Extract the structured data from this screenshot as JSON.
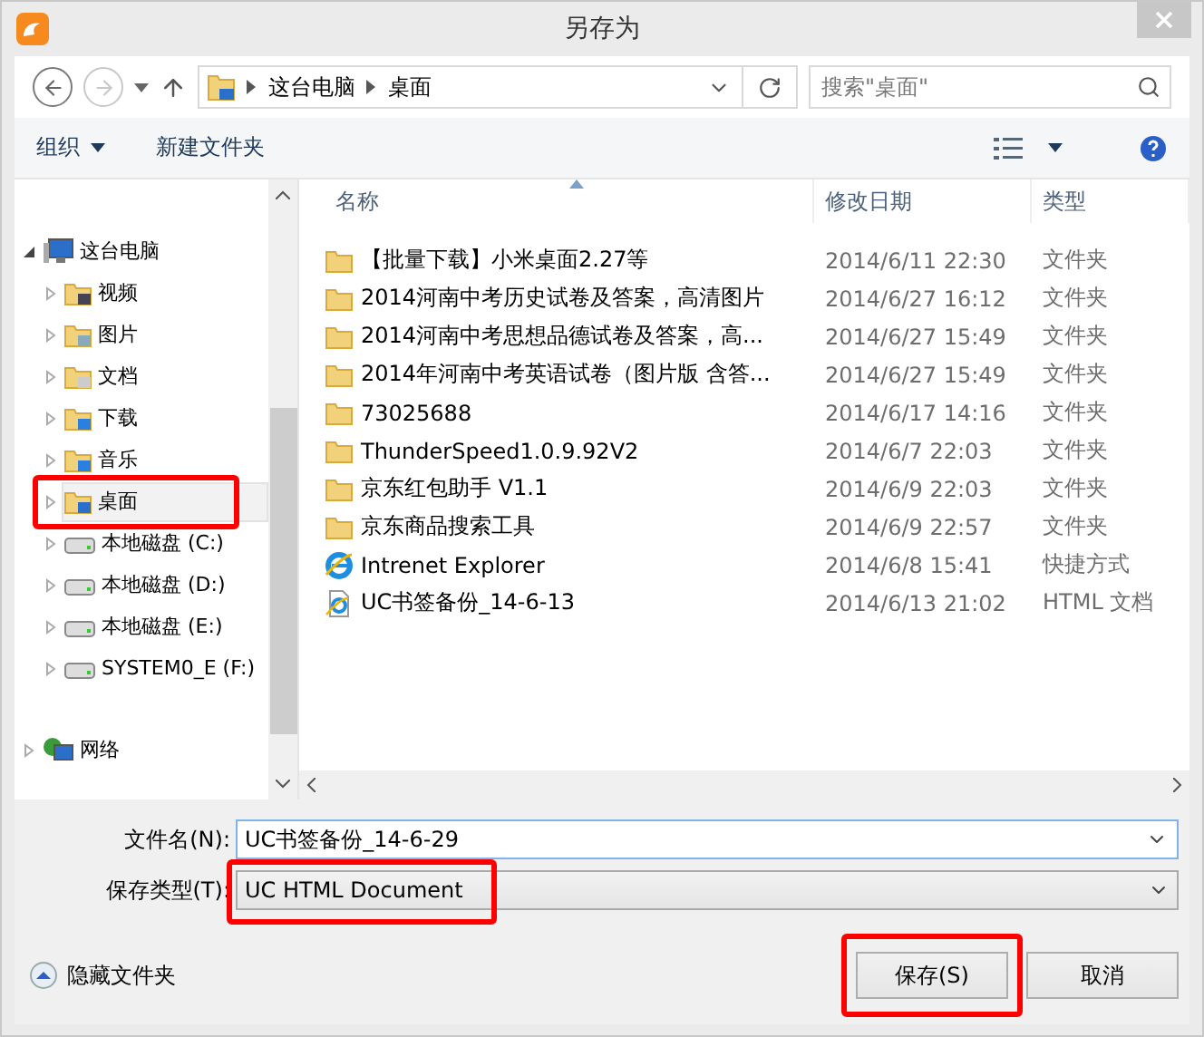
{
  "window": {
    "title": "另存为"
  },
  "address": {
    "segments": [
      "这台电脑",
      "桌面"
    ]
  },
  "search": {
    "placeholder": "搜索\"桌面\""
  },
  "toolbar": {
    "items": [
      {
        "label": "组织",
        "dropdown": true
      },
      {
        "label": "新建文件夹",
        "dropdown": false
      }
    ]
  },
  "tree": [
    {
      "label": "这台电脑",
      "kind": "computer",
      "expanded": true,
      "selected": false,
      "highlighted": false,
      "children": [
        {
          "label": "视频",
          "kind": "folder",
          "expanded": false,
          "selected": false,
          "highlighted": false
        },
        {
          "label": "图片",
          "kind": "folder",
          "expanded": false,
          "selected": false,
          "highlighted": false
        },
        {
          "label": "文档",
          "kind": "folder",
          "expanded": false,
          "selected": false,
          "highlighted": false
        },
        {
          "label": "下载",
          "kind": "folder",
          "expanded": false,
          "selected": false,
          "highlighted": false
        },
        {
          "label": "音乐",
          "kind": "folder",
          "expanded": false,
          "selected": false,
          "highlighted": false
        },
        {
          "label": "桌面",
          "kind": "folder",
          "expanded": false,
          "selected": true,
          "highlighted": true
        },
        {
          "label": "本地磁盘 (C:)",
          "kind": "drive",
          "expanded": false,
          "selected": false,
          "highlighted": false
        },
        {
          "label": "本地磁盘 (D:)",
          "kind": "drive",
          "expanded": false,
          "selected": false,
          "highlighted": false
        },
        {
          "label": "本地磁盘 (E:)",
          "kind": "drive",
          "expanded": false,
          "selected": false,
          "highlighted": false
        },
        {
          "label": "SYSTEM0_E (F:)",
          "kind": "drive",
          "expanded": false,
          "selected": false,
          "highlighted": false
        }
      ]
    },
    {
      "label": "网络",
      "kind": "network",
      "expanded": false,
      "selected": false,
      "highlighted": false
    }
  ],
  "columns": [
    {
      "label": "名称",
      "sorted": true
    },
    {
      "label": "修改日期",
      "sorted": false
    },
    {
      "label": "类型",
      "sorted": false
    }
  ],
  "files": [
    {
      "kind": "folder",
      "name": "【批量下载】小米桌面2.27等",
      "date": "2014/6/11 22:30",
      "type": "文件夹"
    },
    {
      "kind": "folder",
      "name": "2014河南中考历史试卷及答案，高清图片",
      "date": "2014/6/27 16:12",
      "type": "文件夹"
    },
    {
      "kind": "folder",
      "name": "2014河南中考思想品德试卷及答案，高...",
      "date": "2014/6/27 15:49",
      "type": "文件夹"
    },
    {
      "kind": "folder",
      "name": "2014年河南中考英语试卷（图片版 含答...",
      "date": "2014/6/27 15:49",
      "type": "文件夹"
    },
    {
      "kind": "folder",
      "name": "73025688",
      "date": "2014/6/17 14:16",
      "type": "文件夹"
    },
    {
      "kind": "folder",
      "name": "ThunderSpeed1.0.9.92V2",
      "date": "2014/6/7 22:03",
      "type": "文件夹"
    },
    {
      "kind": "folder",
      "name": "京东红包助手 V1.1",
      "date": "2014/6/9 22:03",
      "type": "文件夹"
    },
    {
      "kind": "folder",
      "name": "京东商品搜索工具",
      "date": "2014/6/9 22:57",
      "type": "文件夹"
    },
    {
      "kind": "shortcut",
      "name": "Intrenet Explorer",
      "date": "2014/6/8 15:41",
      "type": "快捷方式"
    },
    {
      "kind": "html",
      "name": "UC书签备份_14-6-13",
      "date": "2014/6/13 21:02",
      "type": "HTML 文档"
    }
  ],
  "filename": {
    "label": "文件名(N):",
    "value": "UC书签备份_14-6-29",
    "highlighted": false
  },
  "filetype": {
    "label": "保存类型(T):",
    "value": "UC HTML Document",
    "highlighted": true
  },
  "hide_folders": {
    "label": "隐藏文件夹"
  },
  "buttons": [
    {
      "label": "保存(S)",
      "highlighted": true
    },
    {
      "label": "取消",
      "highlighted": false
    }
  ]
}
